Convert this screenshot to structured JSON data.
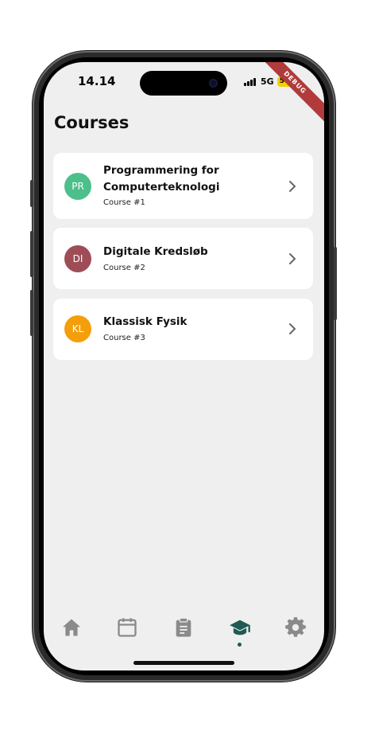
{
  "status_bar": {
    "time": "14.14",
    "network": "5G",
    "battery": "50"
  },
  "debug_banner": "DEBUG",
  "page": {
    "title": "Courses"
  },
  "courses": [
    {
      "initials": "PR",
      "title": "Programmering for Computerteknologi",
      "subtitle": "Course #1",
      "color": "#4cbf8a"
    },
    {
      "initials": "DI",
      "title": "Digitale Kredsløb",
      "subtitle": "Course #2",
      "color": "#9e4d57"
    },
    {
      "initials": "KL",
      "title": "Klassisk Fysik",
      "subtitle": "Course #3",
      "color": "#f59e0b"
    }
  ],
  "nav": {
    "items": [
      "home-icon",
      "calendar-icon",
      "clipboard-icon",
      "graduation-cap-icon",
      "gear-icon"
    ],
    "active_index": 3,
    "active_color": "#1f5a54",
    "inactive_color": "#8a8a8a"
  }
}
